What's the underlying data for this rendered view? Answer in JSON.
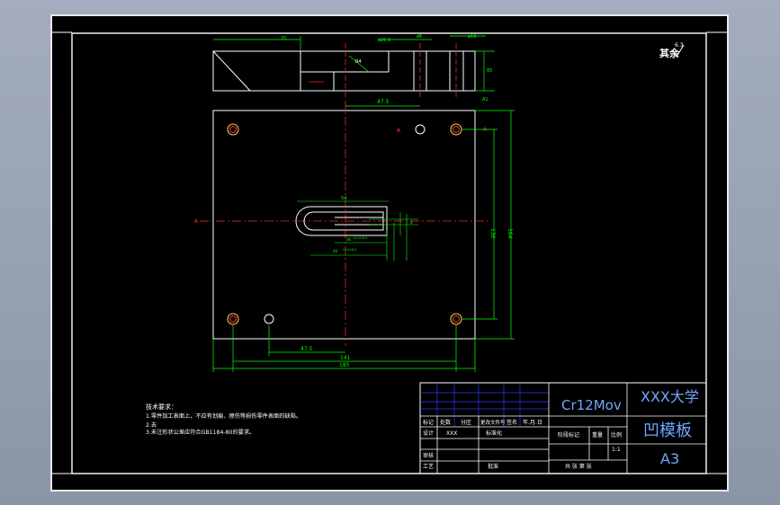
{
  "colors": {
    "background": "#000000",
    "outline": "#ffffff",
    "dimension": "#00ff00",
    "centerline": "#ff2020",
    "hole": "#ff3030",
    "title_text": "#6fa8ff",
    "tech_text": "#ffffff",
    "table_line": "#2a3cff"
  },
  "drawing": {
    "roughness_label": "其余",
    "roughness_value": "6.3",
    "top_view_dims": {
      "left_note": "35",
      "top1": "ø20 0",
      "top2": "ø6",
      "top3": "ø10",
      "right_h": "85",
      "right_label": "A1",
      "inner_label": "R4"
    },
    "plan_dims": {
      "top": "47.5",
      "bottom1": "47.5",
      "bottom2": "141",
      "bottom3": "185",
      "right1": "130",
      "right2": "164",
      "slot_w": "54",
      "slot_a": "36",
      "slot_b": "+0.026 0",
      "slot_c": "40",
      "slot_d": "+0.026 0",
      "slot_e": "8",
      "left_mark": "A",
      "right_mark": "A",
      "hole_mark": "A"
    }
  },
  "technical_requirements": {
    "heading": "技术要求：",
    "lines": [
      "1.零件加工表面上，不应有划痕、擦伤等损伤零件表面的缺陷。",
      "2.去",
      "3.未注形状公差应符合GB1184-80的要求。"
    ]
  },
  "title_block": {
    "material": "Cr12Mov",
    "school": "XXX大学",
    "part_name": "凹模板",
    "sheet_size": "A3",
    "row_labels": [
      "标记",
      "处数",
      "分区",
      "更改文件号",
      "签名",
      "年.月.日"
    ],
    "designer_label": "设计",
    "designer_value": "XXX",
    "standardize_label": "标准化",
    "stage_label": "阶段标记",
    "weight_label": "重量",
    "scale_label": "比例",
    "scale_value": "1:1",
    "review_label": "审核",
    "process_label": "工艺",
    "approve_label": "批准",
    "sheets_text": "共  张 第  张"
  }
}
